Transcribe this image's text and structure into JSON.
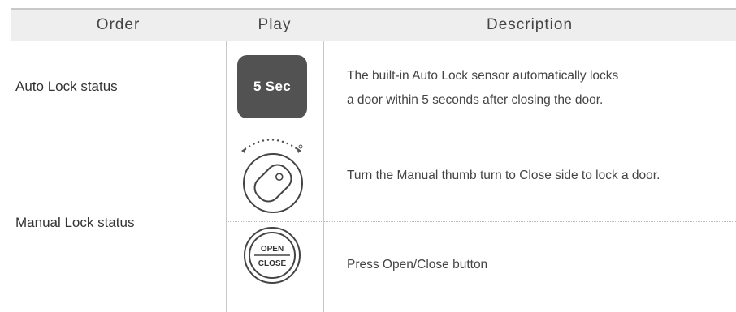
{
  "header": {
    "order": "Order",
    "play": "Play",
    "description": "Description"
  },
  "rows": {
    "auto": {
      "order": "Auto Lock status",
      "badge": "5 Sec",
      "desc_line1": "The built-in Auto Lock sensor automatically locks",
      "desc_line2": "a door within 5 seconds after closing the door."
    },
    "manual": {
      "order": "Manual Lock status",
      "thumb_desc": "Turn the Manual thumb turn to Close side to lock a door.",
      "button_desc": "Press Open/Close button",
      "button_open": "OPEN",
      "button_close": "CLOSE"
    }
  },
  "icons": {
    "thumb_turn": "thumb-turn-icon",
    "open_close_button": "open-close-button-icon"
  },
  "colors": {
    "header_bg": "#eeeeee",
    "badge_bg": "#525252",
    "rule": "#c8c8c8"
  }
}
